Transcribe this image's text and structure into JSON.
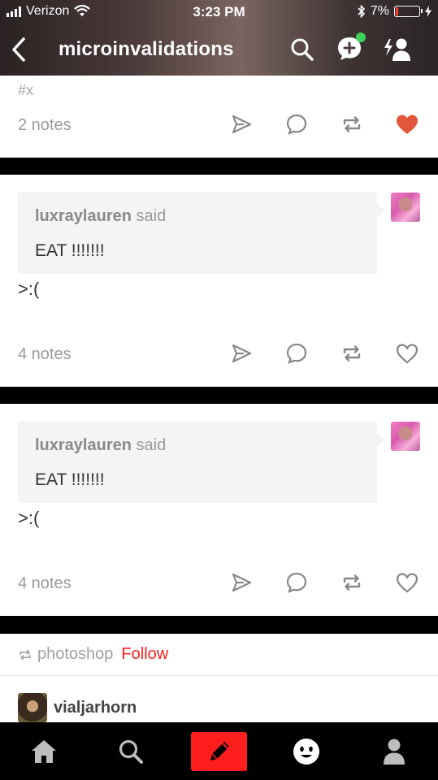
{
  "status_bar": {
    "carrier": "Verizon",
    "time": "3:23 PM",
    "battery_text": "7%",
    "battery_level": 0.07
  },
  "header": {
    "title": "microinvalidations"
  },
  "posts": [
    {
      "tag": "#x",
      "notes": "2 notes",
      "liked": true
    },
    {
      "quote_user": "luxraylauren",
      "quote_said": "said",
      "quote_text": "EAT !!!!!!!",
      "reply": ">:(",
      "notes": "4 notes",
      "liked": false
    },
    {
      "quote_user": "luxraylauren",
      "quote_said": "said",
      "quote_text": "EAT !!!!!!!",
      "reply": ">:(",
      "notes": "4 notes",
      "liked": false
    }
  ],
  "reblog_card": {
    "source": "photoshop",
    "follow_label": "Follow",
    "poster": "vialjarhorn"
  },
  "tabbar": {
    "items": [
      "home-icon",
      "search-icon",
      "compose-icon",
      "activity-icon",
      "account-icon"
    ]
  },
  "colors": {
    "like_red": "#e0573c",
    "follow_red": "#ff1f1f",
    "compose_red": "#ff1e1e"
  }
}
